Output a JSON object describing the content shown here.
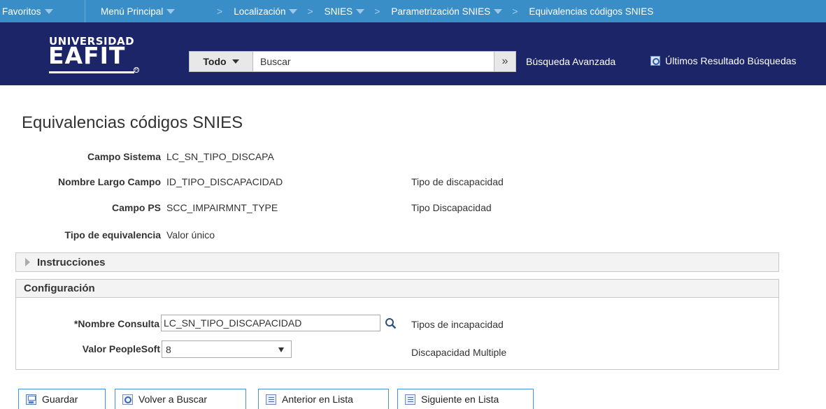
{
  "nav": {
    "favorites": "Favoritos",
    "main_menu": "Menú Principal",
    "breadcrumb": [
      {
        "label": "Localización",
        "has_menu": true
      },
      {
        "label": "SNIES",
        "has_menu": true
      },
      {
        "label": "Parametrización SNIES",
        "has_menu": true
      },
      {
        "label": "Equivalencias códigos SNIES",
        "has_menu": false
      }
    ],
    "separator": ">"
  },
  "header": {
    "logo_top": "UNIVERSIDAD",
    "logo_main": "EAFIT",
    "search_scope": "Todo",
    "search_placeholder": "Buscar",
    "search_go": "»",
    "advanced_search": "Búsqueda Avanzada",
    "last_results": "Últimos Resultado Búsquedas"
  },
  "page": {
    "title": "Equivalencias códigos SNIES",
    "fields": {
      "campo_sistema_label": "Campo Sistema",
      "campo_sistema_value": "LC_SN_TIPO_DISCAPA",
      "nombre_largo_label": "Nombre Largo Campo",
      "nombre_largo_value": "ID_TIPO_DISCAPACIDAD",
      "nombre_largo_desc": "Tipo de discapacidad",
      "campo_ps_label": "Campo PS",
      "campo_ps_value": "SCC_IMPAIRMNT_TYPE",
      "campo_ps_desc": "Tipo Discapacidad",
      "tipo_equiv_label": "Tipo de equivalencia",
      "tipo_equiv_value": "Valor único"
    },
    "instructions_label": "Instrucciones",
    "config": {
      "title": "Configuración",
      "query_label": "*Nombre Consulta",
      "query_value": "LC_SN_TIPO_DISCAPACIDAD",
      "query_desc": "Tipos de incapacidad",
      "ps_value_label": "Valor PeopleSoft",
      "ps_value_selected": "8",
      "ps_value_desc": "Discapacidad Multiple"
    }
  },
  "buttons": {
    "save": "Guardar",
    "return_search": "Volver a Buscar",
    "prev_in_list": "Anterior en Lista",
    "next_in_list": "Siguiente en Lista"
  },
  "colors": {
    "nav_bg": "#3a8ec8",
    "header_bg": "#1b2568",
    "button_border": "#4a90d0"
  },
  "icons": {
    "search_go": "double-chevron-right-icon",
    "last_results": "magnifier-page-icon",
    "lookup": "magnifier-icon",
    "save": "floppy-disk-icon",
    "return_search": "return-search-icon",
    "prev": "previous-list-icon",
    "next": "next-list-icon"
  }
}
